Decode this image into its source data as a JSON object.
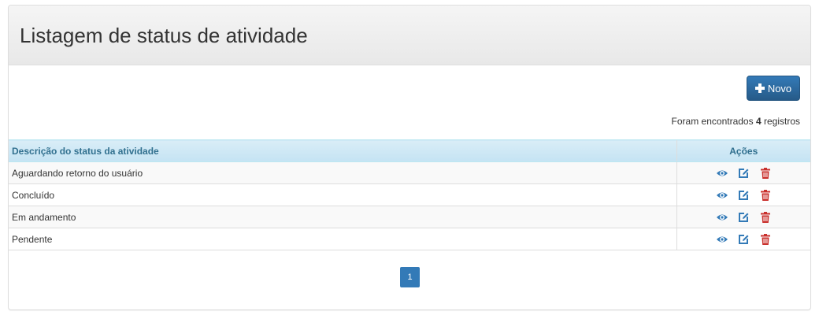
{
  "page": {
    "title": "Listagem de status de atividade"
  },
  "toolbar": {
    "new_label": "Novo"
  },
  "results": {
    "prefix": "Foram encontrados",
    "count": "4",
    "suffix": "registros"
  },
  "table": {
    "columns": [
      "Descrição do status da atividade",
      "Ações"
    ],
    "rows": [
      {
        "description": "Aguardando retorno do usuário"
      },
      {
        "description": "Concluído"
      },
      {
        "description": "Em andamento"
      },
      {
        "description": "Pendente"
      }
    ],
    "action_icons": [
      "eye-icon",
      "edit-icon",
      "trash-icon"
    ]
  },
  "pagination": {
    "current_page": "1"
  },
  "colors": {
    "primary": "#337ab7",
    "header_text": "#31708f",
    "header_bg": "#d9edf7",
    "view_icon": "#337ab7",
    "edit_icon": "#337ab7",
    "delete_icon": "#c9302c"
  }
}
